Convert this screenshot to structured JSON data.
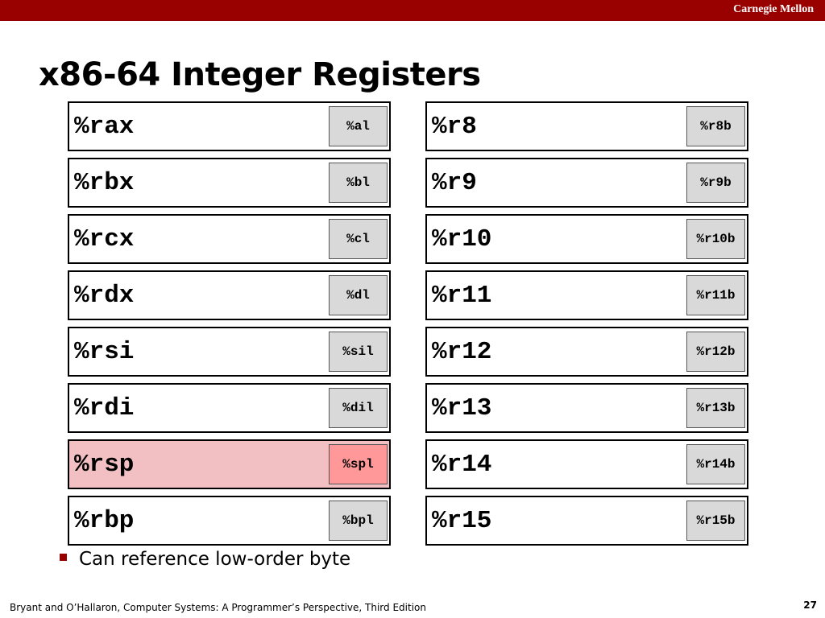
{
  "header": {
    "organization": "Carnegie Mellon",
    "accent_color": "#990000"
  },
  "slide": {
    "title": "x86-64 Integer Registers",
    "highlight_color": "#f2c0c2",
    "highlight_sub_color": "#ff9999",
    "left_registers": [
      {
        "name": "%rax",
        "low_byte": "%al"
      },
      {
        "name": "%rbx",
        "low_byte": "%bl"
      },
      {
        "name": "%rcx",
        "low_byte": "%cl"
      },
      {
        "name": "%rdx",
        "low_byte": "%dl"
      },
      {
        "name": "%rsi",
        "low_byte": "%sil"
      },
      {
        "name": "%rdi",
        "low_byte": "%dil"
      },
      {
        "name": "%rsp",
        "low_byte": "%spl",
        "highlighted": true
      },
      {
        "name": "%rbp",
        "low_byte": "%bpl"
      }
    ],
    "right_registers": [
      {
        "name": "%r8",
        "low_byte": "%r8b"
      },
      {
        "name": "%r9",
        "low_byte": "%r9b"
      },
      {
        "name": "%r10",
        "low_byte": "%r10b"
      },
      {
        "name": "%r11",
        "low_byte": "%r11b"
      },
      {
        "name": "%r12",
        "low_byte": "%r12b"
      },
      {
        "name": "%r13",
        "low_byte": "%r13b"
      },
      {
        "name": "%r14",
        "low_byte": "%r14b"
      },
      {
        "name": "%r15",
        "low_byte": "%r15b"
      }
    ],
    "note": "Can reference low-order byte"
  },
  "footer": {
    "citation": "Bryant and O’Hallaron, Computer Systems: A Programmer’s Perspective, Third Edition",
    "page_number": "27"
  }
}
